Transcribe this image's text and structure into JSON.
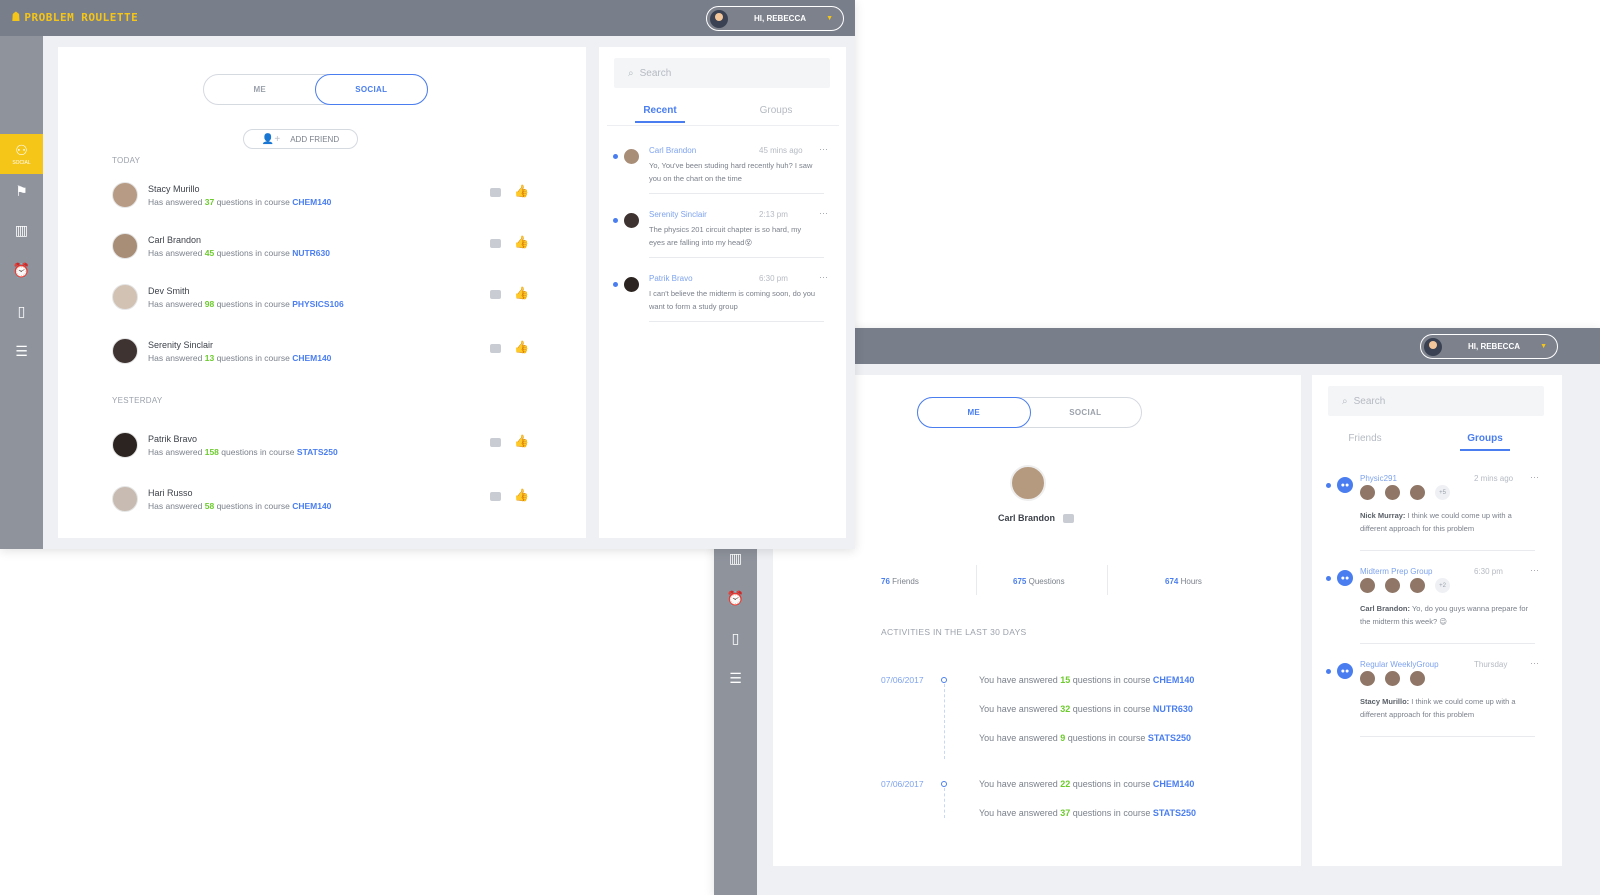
{
  "app": {
    "logo_text": "PROBLEM ROULETTE",
    "user_greeting": "HI, REBECCA"
  },
  "sidebar": {
    "social_label": "SOCIAL"
  },
  "social_view": {
    "toggle": {
      "me": "ME",
      "social": "SOCIAL"
    },
    "add_friend": "ADD FRIEND",
    "today_label": "TODAY",
    "yesterday_label": "YESTERDAY",
    "feed_prefix": "Has answered",
    "feed_mid": "questions in course",
    "feed": [
      {
        "name": "Stacy Murillo",
        "count": "37",
        "course": "CHEM140",
        "liked": true
      },
      {
        "name": "Carl Brandon",
        "count": "45",
        "course": "NUTR630",
        "liked": false
      },
      {
        "name": "Dev Smith",
        "count": "98",
        "course": "PHYSICS106",
        "liked": false
      },
      {
        "name": "Serenity Sinclair",
        "count": "13",
        "course": "CHEM140",
        "liked": false
      },
      {
        "name": "Patrik Bravo",
        "count": "158",
        "course": "STATS250",
        "liked": false
      },
      {
        "name": "Hari Russo",
        "count": "58",
        "course": "CHEM140",
        "liked": false
      }
    ],
    "chat": {
      "search_placeholder": "Search",
      "tab_recent": "Recent",
      "tab_groups": "Groups",
      "messages": [
        {
          "from": "Carl Brandon",
          "time": "45 mins ago",
          "text": "Yo, You've been studing hard recently huh? I saw you on the chart on the time"
        },
        {
          "from": "Serenity Sinclair",
          "time": "2:13 pm",
          "text": "The physics 201 circuit chapter is so hard, my eyes are falling into my head😵"
        },
        {
          "from": "Patrik Bravo",
          "time": "6:30 pm",
          "text": "I can't believe the midterm is coming soon, do you want to form a study group"
        }
      ]
    }
  },
  "me_view": {
    "toggle": {
      "me": "ME",
      "social": "SOCIAL"
    },
    "profile_name": "Carl Brandon",
    "stats": {
      "friends_value": "76",
      "friends_label": "Friends",
      "questions_value": "675",
      "questions_label": "Questions",
      "hours_value": "674",
      "hours_label": "Hours"
    },
    "activity_title": "ACTIVITIES IN THE LAST 30 DAYS",
    "act_prefix": "You have answered",
    "act_mid": "questions in course",
    "activities": [
      {
        "date": "07/06/2017",
        "items": [
          {
            "count": "15",
            "course": "CHEM140"
          },
          {
            "count": "32",
            "course": "NUTR630"
          },
          {
            "count": "9",
            "course": "STATS250"
          }
        ]
      },
      {
        "date": "07/06/2017",
        "items": [
          {
            "count": "22",
            "course": "CHEM140"
          },
          {
            "count": "37",
            "course": "STATS250"
          }
        ]
      }
    ],
    "chat": {
      "search_placeholder": "Search",
      "tab_friends": "Friends",
      "tab_groups": "Groups",
      "groups": [
        {
          "name": "Physic291",
          "time": "2 mins ago",
          "extra": "+5",
          "author": "Nick Murray:",
          "text": "I think we could come up with a different approach for this problem"
        },
        {
          "name": "Midterm Prep Group",
          "time": "6:30 pm",
          "extra": "+2",
          "author": "Carl Brandon:",
          "text": "Yo, do you guys wanna prepare for the midterm this week? 😉"
        },
        {
          "name": "Regular WeeklyGroup",
          "time": "Thursday",
          "extra": "",
          "author": "Stacy Murillo:",
          "text": "I think we could come up with a different approach for this problem"
        }
      ]
    }
  },
  "colors": {
    "accent": "#4a7ef0",
    "count_green": "#6dcb2e",
    "brand_yellow": "#f5c518",
    "topbar": "#787e8a"
  }
}
